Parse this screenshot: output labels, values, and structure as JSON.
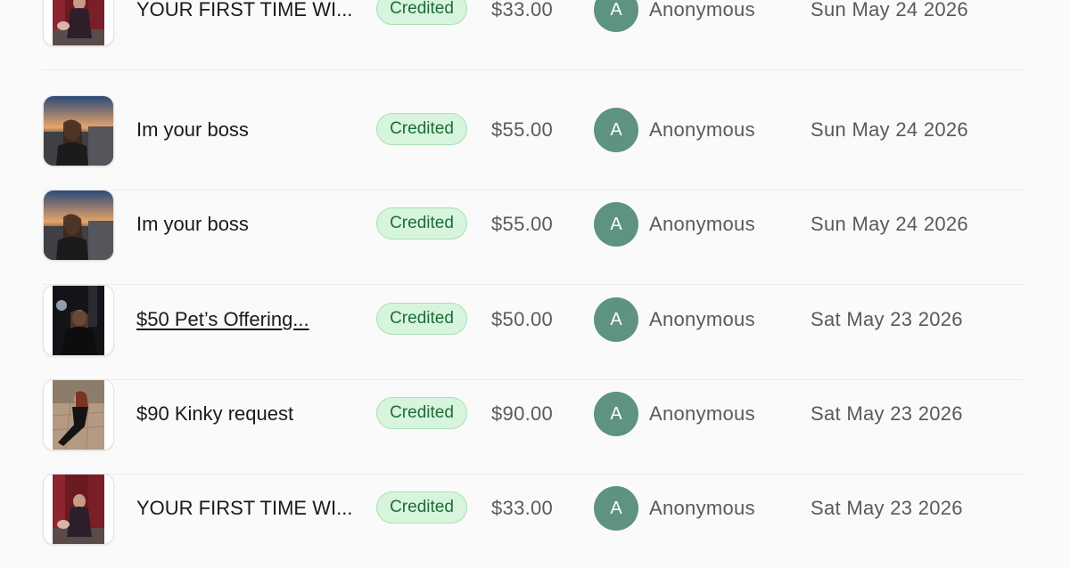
{
  "transactions": [
    {
      "title": "YOUR FIRST TIME WI...",
      "status": "Credited",
      "amount": "$33.00",
      "avatar_initial": "A",
      "buyer": "Anonymous",
      "date": "Sun May 24 2026",
      "thumbnail": "red-room-photo"
    },
    {
      "title": "Im your boss",
      "status": "Credited",
      "amount": "$55.00",
      "avatar_initial": "A",
      "buyer": "Anonymous",
      "date": "Sun May 24 2026",
      "thumbnail": "sunset-rooftop-photo"
    },
    {
      "title": "Im your boss",
      "status": "Credited",
      "amount": "$55.00",
      "avatar_initial": "A",
      "buyer": "Anonymous",
      "date": "Sun May 24 2026",
      "thumbnail": "sunset-rooftop-photo"
    },
    {
      "title": "$50 Pet’s Offering...",
      "status": "Credited",
      "amount": "$50.00",
      "avatar_initial": "A",
      "buyer": "Anonymous",
      "date": "Sat May 23 2026",
      "thumbnail": "dark-room-photo"
    },
    {
      "title": "$90 Kinky request",
      "status": "Credited",
      "amount": "$90.00",
      "avatar_initial": "A",
      "buyer": "Anonymous",
      "date": "Sat May 23 2026",
      "thumbnail": "tiled-floor-photo"
    },
    {
      "title": "YOUR FIRST TIME WI...",
      "status": "Credited",
      "amount": "$33.00",
      "avatar_initial": "A",
      "buyer": "Anonymous",
      "date": "Sat May 23 2026",
      "thumbnail": "red-room-photo"
    }
  ],
  "colors": {
    "badge_bg": "#d7f5dc",
    "badge_text": "#1f6b39",
    "avatar_bg": "#5e9283",
    "muted_text": "#5a5a5a"
  }
}
